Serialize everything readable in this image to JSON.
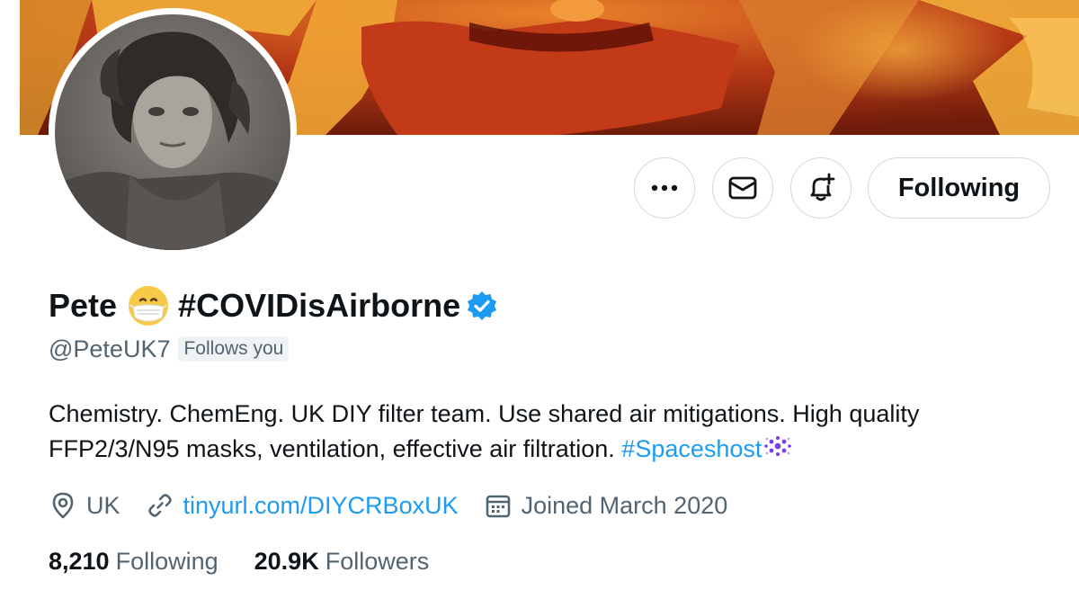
{
  "profile": {
    "name": "Pete",
    "name_hashtag": "#COVIDisAirborne",
    "handle": "@PeteUK7",
    "follows_you_badge": "Follows you",
    "bio_text": "Chemistry. ChemEng. UK DIY filter team. Use shared air mitigations. High quality FFP2/3/N95 masks, ventilation, effective air filtration.",
    "bio_hashtag": "#Spaceshost",
    "location": "UK",
    "website": "tinyurl.com/DIYCRBoxUK",
    "joined": "Joined March 2020",
    "verified": true
  },
  "actions": {
    "more_icon": "more-horizontal-icon",
    "message_icon": "envelope-icon",
    "notify_icon": "bell-plus-icon",
    "following_label": "Following"
  },
  "stats": {
    "following_value": "8,210",
    "following_label": "Following",
    "followers_value": "20.9K",
    "followers_label": "Followers"
  },
  "icons": {
    "location": "map-pin-icon",
    "website": "link-icon",
    "joined": "calendar-icon",
    "name_emoji": "face-with-mask-icon",
    "verified": "verified-badge-icon",
    "bio_emoji": "sparkles-icon"
  },
  "colors": {
    "accent": "#1d9bf0",
    "text_primary": "#0f1419",
    "text_secondary": "#536471",
    "border": "#cfd9de",
    "badge_bg": "#eff3f4"
  }
}
